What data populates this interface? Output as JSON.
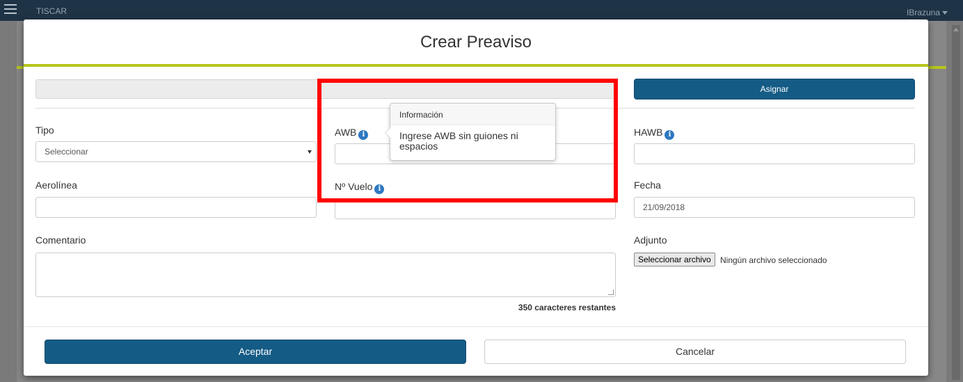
{
  "topbar": {
    "app_title": "TISCAR",
    "user_name": "IBrazuna"
  },
  "modal": {
    "title": "Crear Preaviso",
    "assign_label": "Asignar",
    "fields": {
      "tipo": {
        "label": "Tipo",
        "value": "Seleccionar"
      },
      "awb": {
        "label": "AWB",
        "value": ""
      },
      "hawb": {
        "label": "HAWB",
        "value": ""
      },
      "aerolinea": {
        "label": "Aerolínea",
        "value": ""
      },
      "vuelo": {
        "label": "Nº Vuelo",
        "value": ""
      },
      "fecha": {
        "label": "Fecha",
        "value": "21/09/2018"
      },
      "comentario": {
        "label": "Comentario",
        "value": "",
        "counter": "350 caracteres restantes"
      },
      "adjunto": {
        "label": "Adjunto",
        "button": "Seleccionar archivo",
        "status": "Ningún archivo seleccionado"
      }
    },
    "footer": {
      "accept_label": "Aceptar",
      "cancel_label": "Cancelar"
    },
    "popover": {
      "title": "Información",
      "body": "Ingrese AWB sin guiones ni espacios"
    }
  },
  "icons": {
    "info": "i"
  },
  "colors": {
    "topbar": "#1f3346",
    "primary": "#145b85",
    "accent_line": "#b7c61b",
    "info_icon": "#2e78c2",
    "highlight": "#ff0000"
  }
}
